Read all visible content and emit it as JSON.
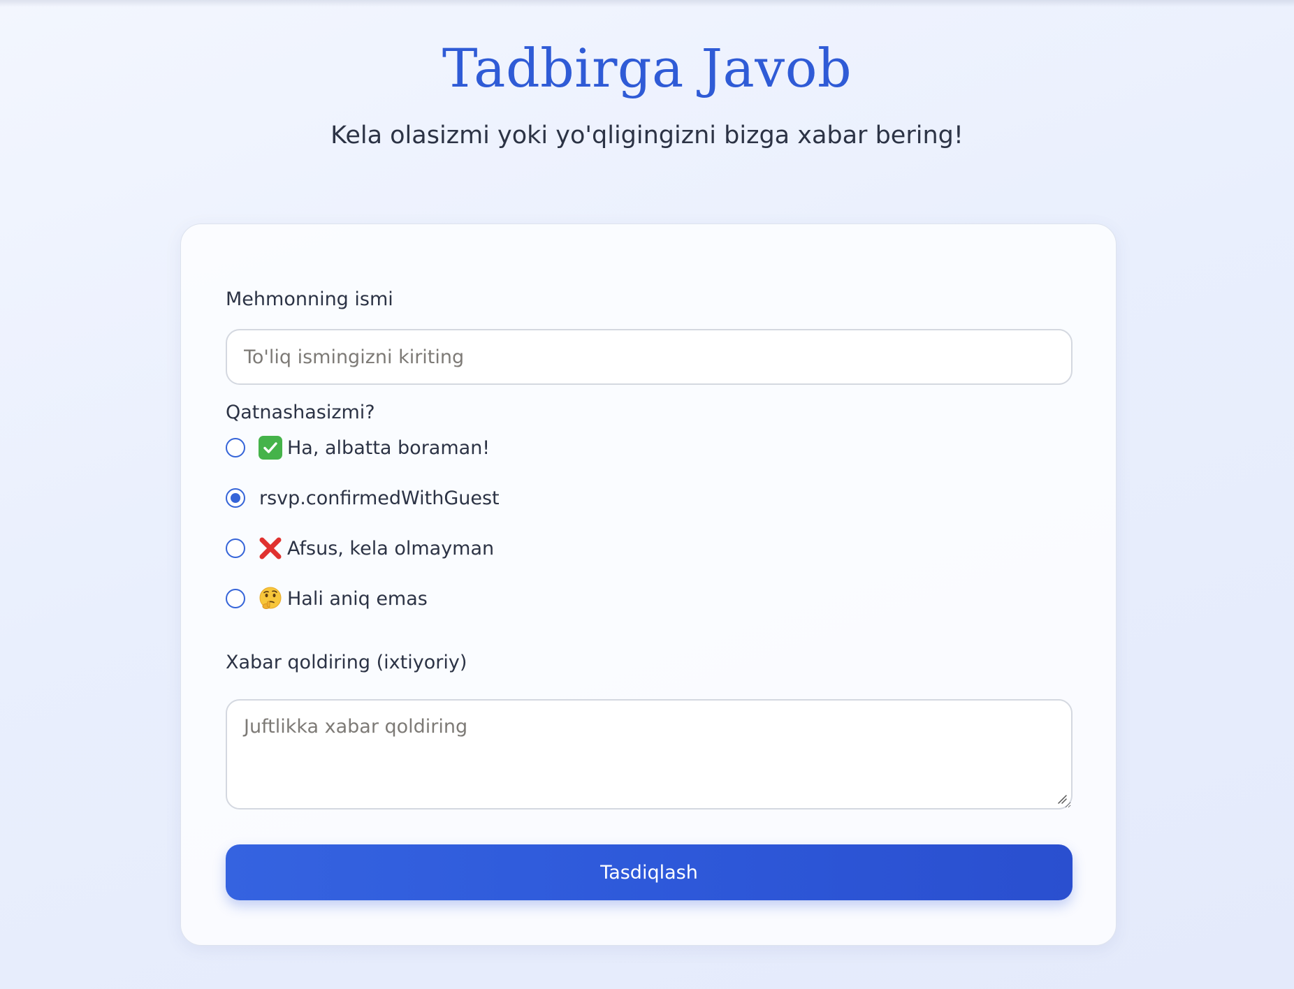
{
  "header": {
    "title": "Tadbirga Javob",
    "subtitle": "Kela olasizmi yoki yo'qligingizni bizga xabar bering!"
  },
  "form": {
    "name_label": "Mehmonning ismi",
    "name_placeholder": "To'liq ismingizni kiriting",
    "name_value": "",
    "attendance_label": "Qatnashasizmi?",
    "attendance_options": [
      {
        "icon": "check-mark-emoji-icon",
        "label": "Ha, albatta boraman!",
        "selected": false
      },
      {
        "icon": "",
        "label": "rsvp.confirmedWithGuest",
        "selected": true
      },
      {
        "icon": "cross-mark-emoji-icon",
        "label": "Afsus, kela olmayman",
        "selected": false
      },
      {
        "icon": "thinking-face-emoji-icon",
        "label": "Hali aniq emas",
        "selected": false
      }
    ],
    "message_label": "Xabar qoldiring (ixtiyoriy)",
    "message_placeholder": "Juftlikka xabar qoldiring",
    "message_value": "",
    "submit_label": "Tasdiqlash"
  },
  "colors": {
    "accent": "#2f5bd6",
    "button_start": "#3563e0",
    "button_end": "#2a4fcf",
    "text": "#2c3345",
    "placeholder": "#7d7a76"
  }
}
